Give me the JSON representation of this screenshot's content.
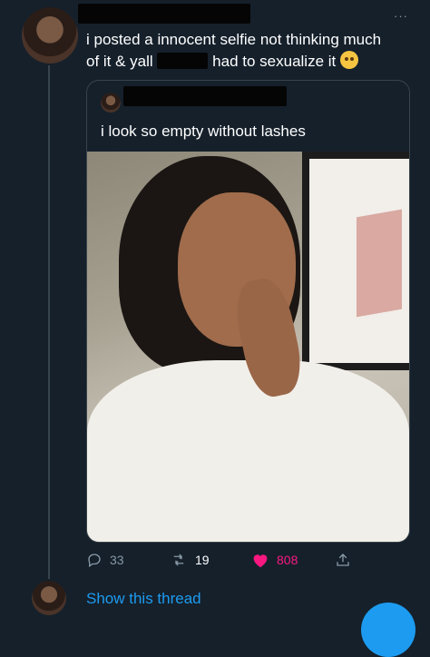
{
  "tweet": {
    "text_line1": "i posted a innocent selfie not thinking much",
    "text_line2_start": "of it & yall",
    "text_line2_end": "had to sexualize it",
    "more_label": "···",
    "emoji": "crying-face-emoji"
  },
  "quoted_tweet": {
    "text": "i look so empty without lashes",
    "image": "selfie-photo"
  },
  "actions": {
    "replies": "33",
    "retweets": "19",
    "likes": "808"
  },
  "thread": {
    "show_label": "Show this thread"
  },
  "colors": {
    "background": "#15202b",
    "accent": "#1d9bf0",
    "like": "#f91880",
    "muted": "#8899a6"
  }
}
